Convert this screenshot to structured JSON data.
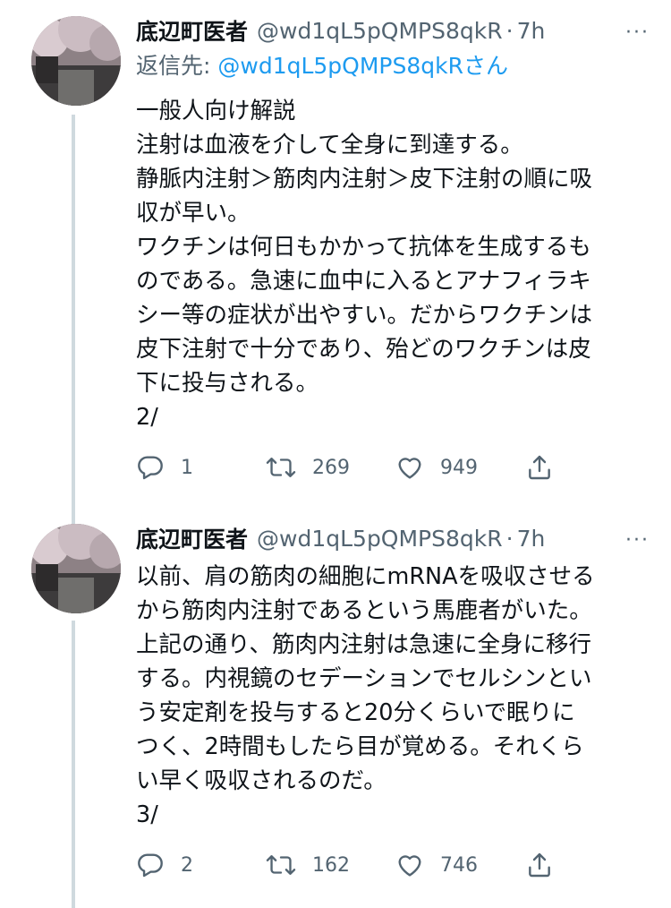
{
  "tweets": [
    {
      "author_name": "底辺町医者",
      "handle": "@wd1qL5pQMPS8qkR",
      "separator": "·",
      "time": "7h",
      "more": "···",
      "reply_prefix": "返信先: ",
      "reply_handle": "@wd1qL5pQMPS8qkR",
      "reply_suffix": "さん",
      "text": "一般人向け解説\n注射は血液を介して全身に到達する。\n静脈内注射＞筋肉内注射＞皮下注射の順に吸\n収が早い。\nワクチンは何日もかかって抗体を生成するも\nのである。急速に血中に入るとアナフィラキ\nシー等の症状が出やすい。だからワクチンは\n皮下注射で十分であり、殆どのワクチンは皮\n下に投与される。\n2/",
      "replies": "1",
      "retweets": "269",
      "likes": "949"
    },
    {
      "author_name": "底辺町医者",
      "handle": "@wd1qL5pQMPS8qkR",
      "separator": "·",
      "time": "7h",
      "more": "···",
      "text": "以前、肩の筋肉の細胞にmRNAを吸収させる\nから筋肉内注射であるという馬鹿者がいた。\n上記の通り、筋肉内注射は急速に全身に移行\nする。内視鏡のセデーションでセルシンとい\nう安定剤を投与すると20分くらいで眠りに\nつく、2時間もしたら目が覚める。それくら\nい早く吸収されるのだ。\n3/",
      "replies": "2",
      "retweets": "162",
      "likes": "746"
    }
  ],
  "colors": {
    "text": "#0f1419",
    "secondary": "#536471",
    "link": "#1d9bf0",
    "thread_line": "#cfd9de"
  },
  "icons": {
    "reply": "speech-bubble-icon",
    "retweet": "retweet-arrows-icon",
    "like": "heart-icon",
    "share": "share-upload-icon",
    "more": "ellipsis-icon"
  }
}
